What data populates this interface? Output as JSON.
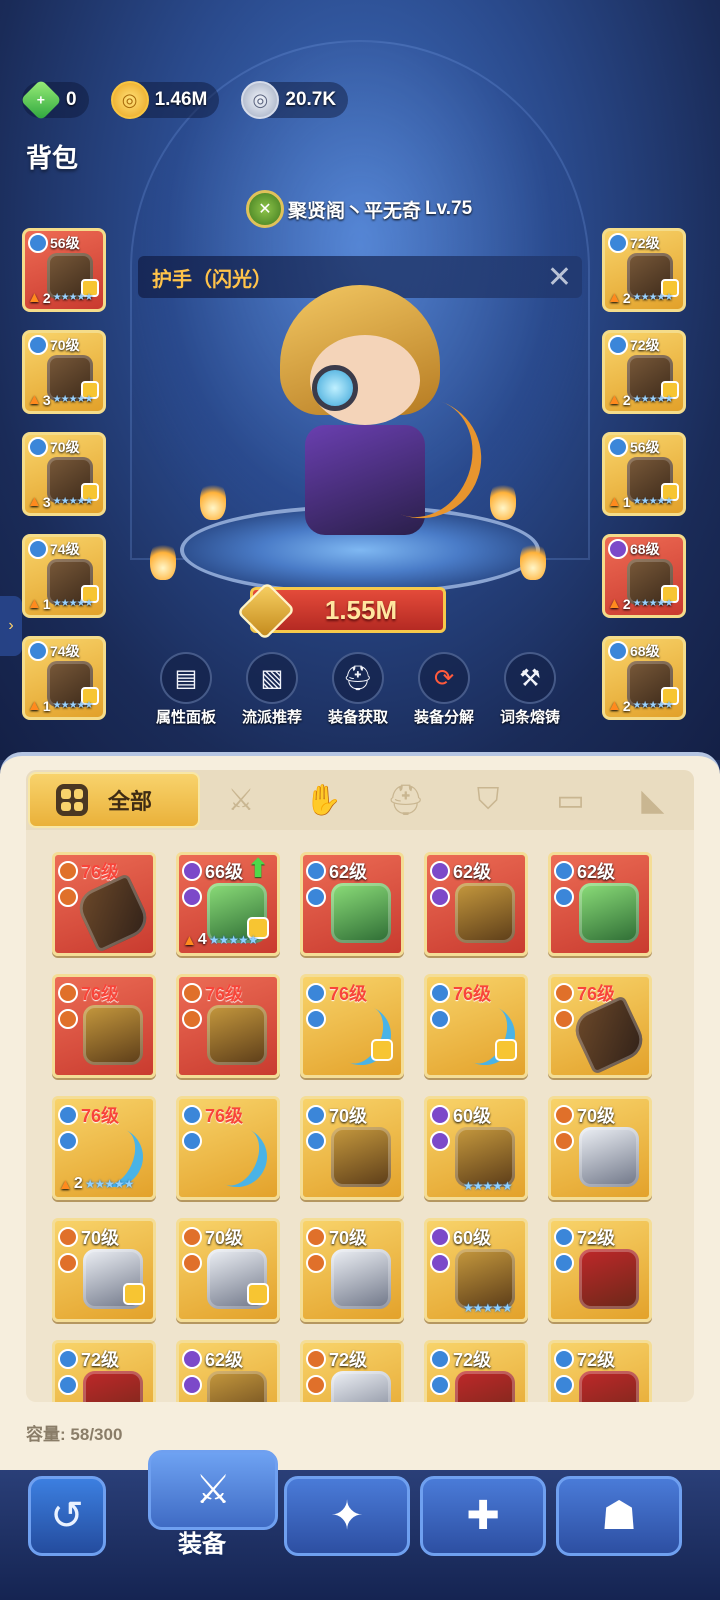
{
  "currencies": {
    "gems": "0",
    "gold": "1.46M",
    "silver": "20.7K"
  },
  "page_title": "背包",
  "player": {
    "guild_name": "聚贤阁丶平无奇",
    "level": "Lv.75"
  },
  "detail": {
    "title": "护手（闪光）",
    "close": "✕"
  },
  "power": "1.55M",
  "left_slots": [
    {
      "level": "56级",
      "rank": "2",
      "element": "blue",
      "bg": "red"
    },
    {
      "level": "70级",
      "rank": "3",
      "element": "blue",
      "bg": "gold"
    },
    {
      "level": "70级",
      "rank": "3",
      "element": "blue",
      "bg": "gold"
    },
    {
      "level": "74级",
      "rank": "1",
      "element": "blue",
      "bg": "gold"
    },
    {
      "level": "74级",
      "rank": "1",
      "element": "blue",
      "bg": "gold"
    }
  ],
  "right_slots": [
    {
      "level": "72级",
      "rank": "2",
      "element": "blue",
      "bg": "gold"
    },
    {
      "level": "72级",
      "rank": "2",
      "element": "blue",
      "bg": "gold"
    },
    {
      "level": "56级",
      "rank": "1",
      "element": "blue",
      "bg": "gold"
    },
    {
      "level": "68级",
      "rank": "2",
      "element": "purple",
      "bg": "red"
    },
    {
      "level": "68级",
      "rank": "2",
      "element": "blue",
      "bg": "gold"
    }
  ],
  "actions": [
    {
      "label": "属性面板",
      "icon": "book-icon"
    },
    {
      "label": "流派推荐",
      "icon": "scroll-icon"
    },
    {
      "label": "装备获取",
      "icon": "helmet-icon"
    },
    {
      "label": "装备分解",
      "icon": "recycle-icon"
    },
    {
      "label": "词条熔铸",
      "icon": "anvil-icon"
    }
  ],
  "tabs": {
    "all_label": "全部",
    "categories": [
      "weapon-icon",
      "glove-icon",
      "helmet-icon",
      "armor-icon",
      "pants-icon",
      "boots-icon"
    ]
  },
  "items": [
    {
      "level": "76级",
      "bg": "red",
      "element": "orange",
      "art": "weapon",
      "red_text": true,
      "lock": false
    },
    {
      "level": "66级",
      "bg": "red",
      "element": "purple",
      "art": "green",
      "red_text": false,
      "lock": true,
      "rank": "4",
      "upgrade": true
    },
    {
      "level": "62级",
      "bg": "red",
      "element": "blue",
      "art": "green",
      "red_text": false,
      "lock": false
    },
    {
      "level": "62级",
      "bg": "red",
      "element": "purple",
      "art": "armor",
      "red_text": false,
      "lock": false
    },
    {
      "level": "62级",
      "bg": "red",
      "element": "blue",
      "art": "green",
      "red_text": false,
      "lock": false
    },
    {
      "level": "76级",
      "bg": "red",
      "element": "orange",
      "art": "armor",
      "red_text": true,
      "lock": false
    },
    {
      "level": "76级",
      "bg": "red",
      "element": "orange",
      "art": "armor",
      "red_text": true,
      "lock": false
    },
    {
      "level": "76级",
      "bg": "gold",
      "element": "blue",
      "art": "bow",
      "red_text": true,
      "lock": true
    },
    {
      "level": "76级",
      "bg": "gold",
      "element": "blue",
      "art": "bow",
      "red_text": true,
      "lock": true
    },
    {
      "level": "76级",
      "bg": "gold",
      "element": "orange",
      "art": "weapon",
      "red_text": true,
      "lock": false
    },
    {
      "level": "76级",
      "bg": "gold",
      "element": "blue",
      "art": "bow",
      "red_text": true,
      "lock": false,
      "rank": "2"
    },
    {
      "level": "76级",
      "bg": "gold",
      "element": "blue",
      "art": "bow",
      "red_text": true,
      "lock": false
    },
    {
      "level": "70级",
      "bg": "gold",
      "element": "blue",
      "art": "armor",
      "red_text": false,
      "lock": false
    },
    {
      "level": "60级",
      "bg": "gold",
      "element": "purple",
      "art": "armor",
      "red_text": false,
      "lock": false,
      "stars_only": true
    },
    {
      "level": "70级",
      "bg": "gold",
      "element": "orange",
      "art": "metal",
      "red_text": false,
      "lock": false
    },
    {
      "level": "70级",
      "bg": "gold",
      "element": "orange",
      "art": "metal",
      "red_text": false,
      "lock": true
    },
    {
      "level": "70级",
      "bg": "gold",
      "element": "orange",
      "art": "metal",
      "red_text": false,
      "lock": true
    },
    {
      "level": "70级",
      "bg": "gold",
      "element": "orange",
      "art": "metal",
      "red_text": false,
      "lock": false
    },
    {
      "level": "60级",
      "bg": "gold",
      "element": "purple",
      "art": "armor",
      "red_text": false,
      "lock": false,
      "stars_only": true
    },
    {
      "level": "72级",
      "bg": "gold",
      "element": "blue",
      "art": "redarmor",
      "red_text": false,
      "lock": false
    },
    {
      "level": "72级",
      "bg": "gold",
      "element": "blue",
      "art": "redarmor",
      "red_text": false,
      "lock": false
    },
    {
      "level": "62级",
      "bg": "gold",
      "element": "purple",
      "art": "armor",
      "red_text": false,
      "lock": false
    },
    {
      "level": "72级",
      "bg": "gold",
      "element": "orange",
      "art": "metal",
      "red_text": false,
      "lock": false
    },
    {
      "level": "72级",
      "bg": "gold",
      "element": "blue",
      "art": "redarmor",
      "red_text": false,
      "lock": false
    },
    {
      "level": "72级",
      "bg": "gold",
      "element": "blue",
      "art": "redarmor",
      "red_text": false,
      "lock": false
    }
  ],
  "capacity": {
    "label": "容量:",
    "value": "58/300"
  },
  "bottom_nav": {
    "active_label": "装备",
    "buttons": [
      "back-icon",
      "equipment-icon",
      "treasure-icon",
      "puzzle-icon",
      "mask-icon"
    ]
  },
  "colors": {
    "accent_gold": "#f6c94b",
    "item_red": "#c93b2f",
    "item_gold": "#e3a22b"
  }
}
